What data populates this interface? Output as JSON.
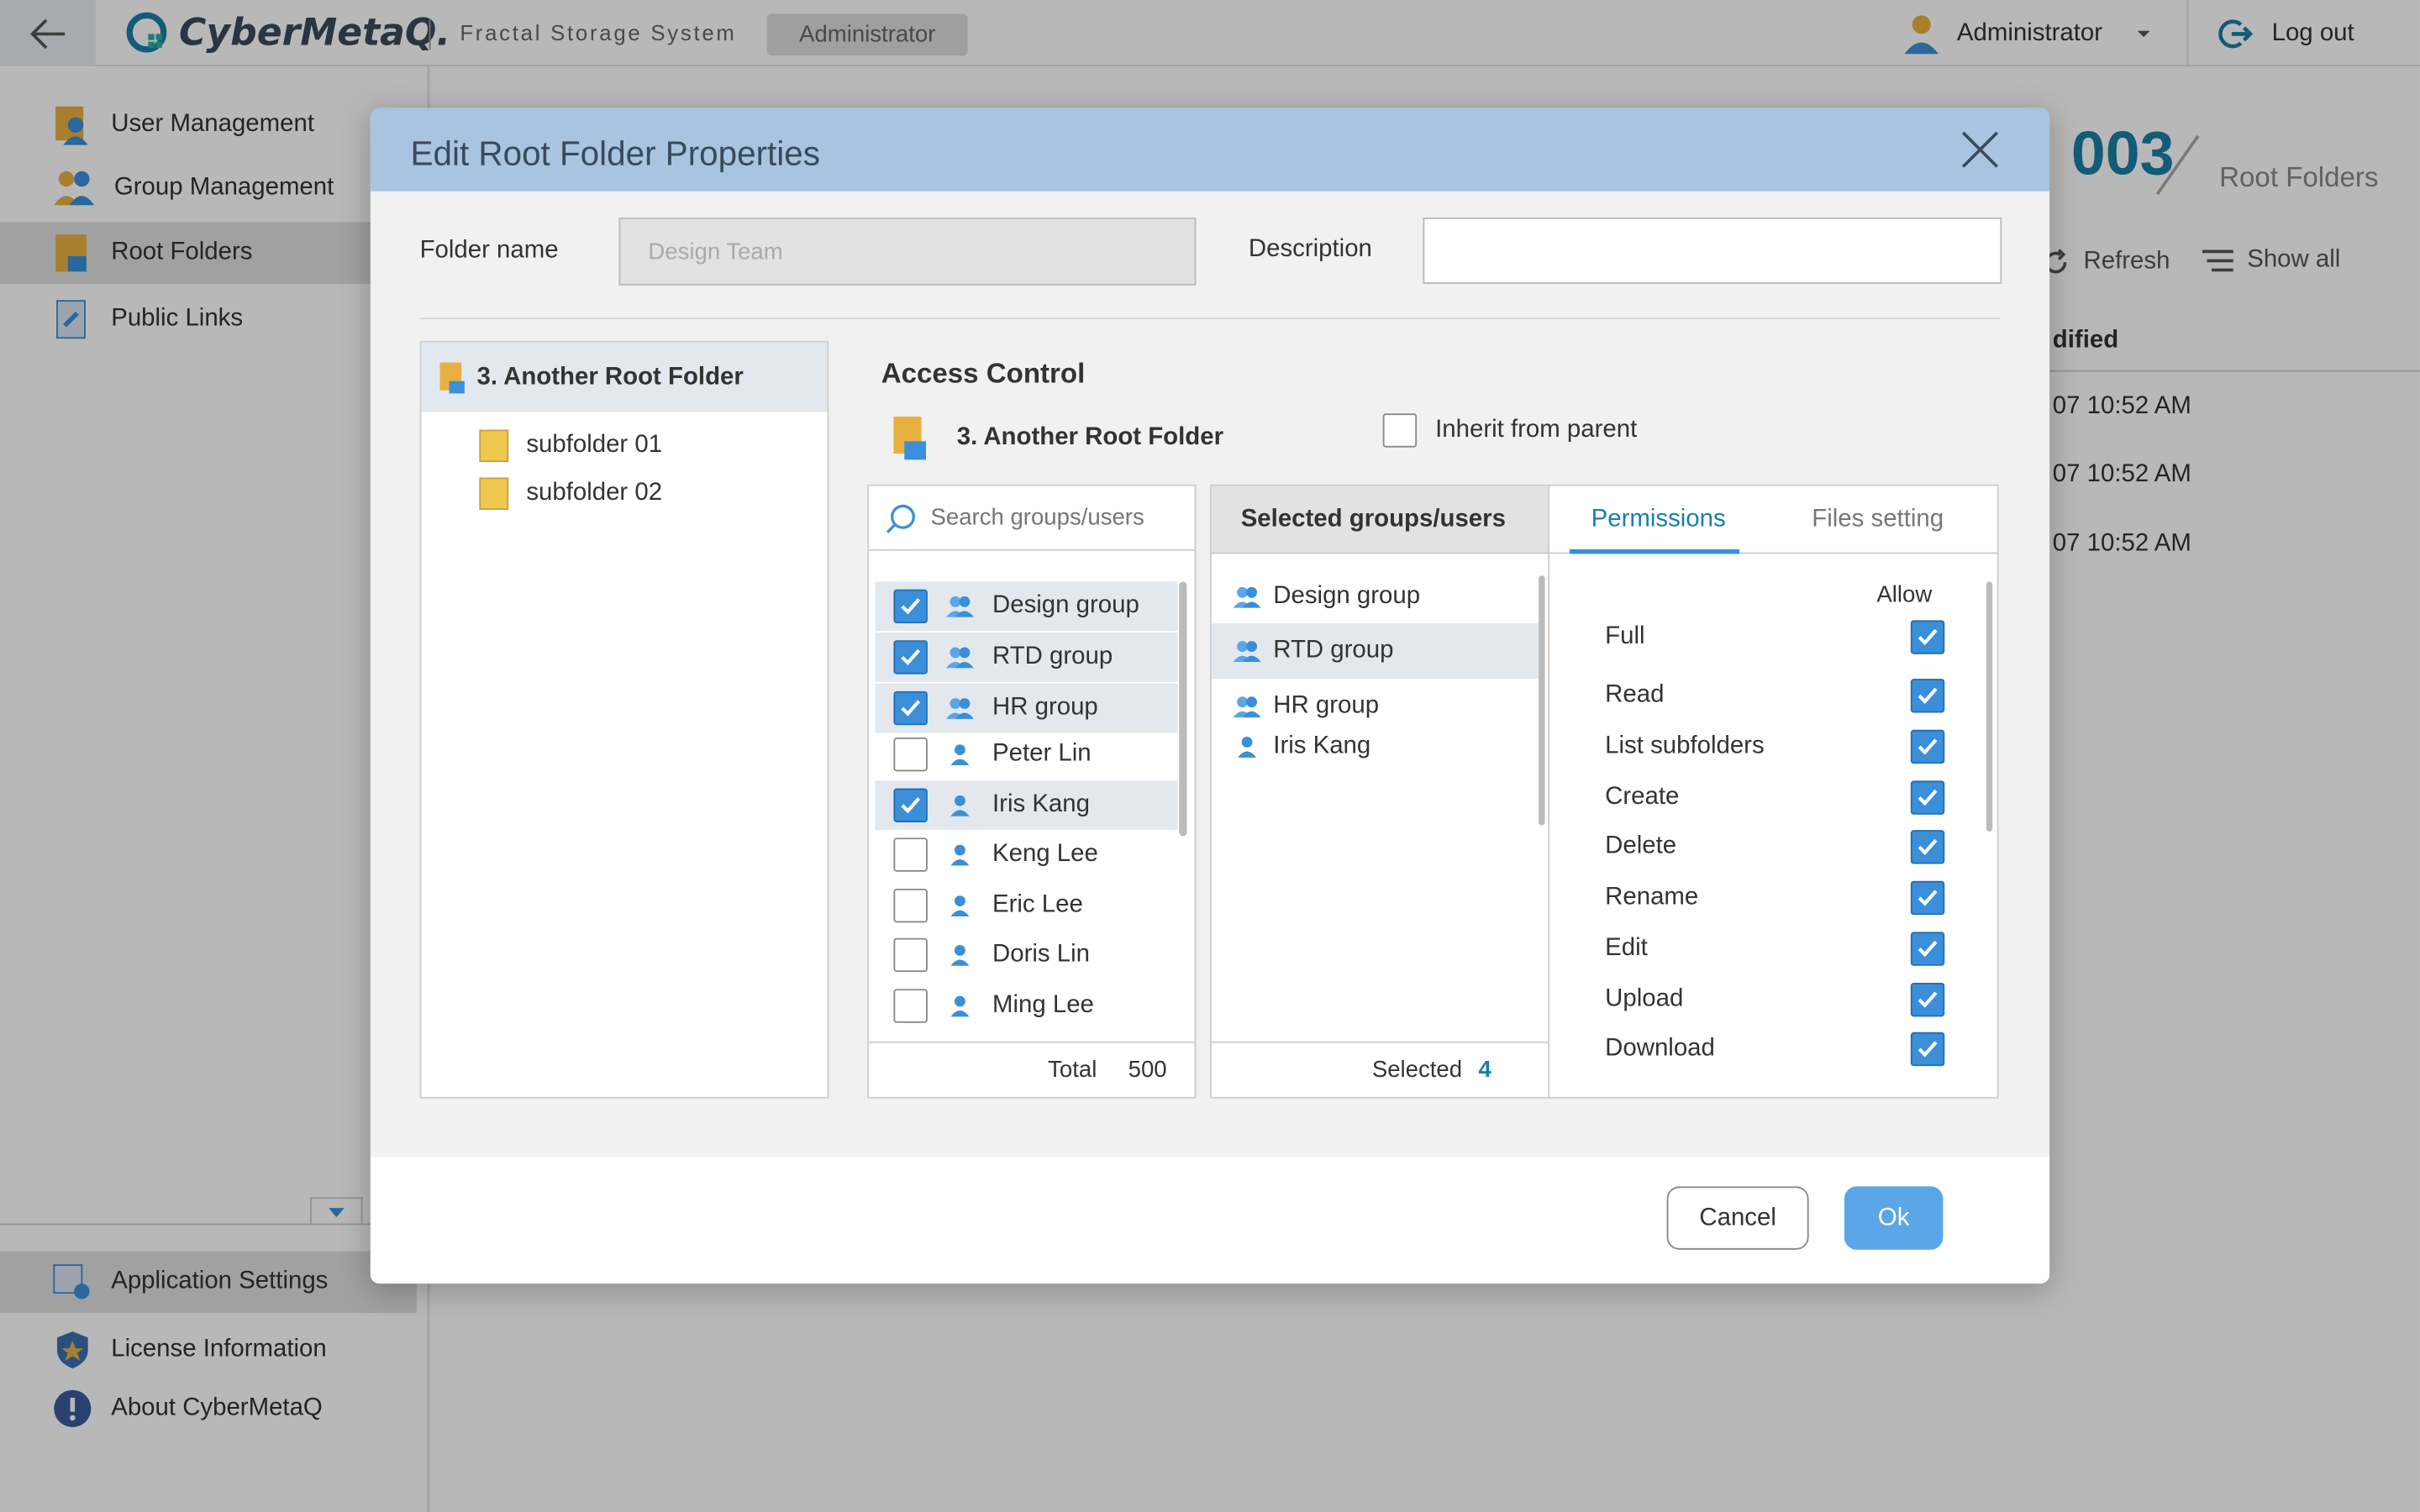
{
  "topbar": {
    "logo_text": "CyberMetaQ.",
    "system_name": "Fractal Storage System",
    "role_badge": "Administrator",
    "user_name": "Administrator",
    "logout_label": "Log out"
  },
  "sidebar": {
    "items": [
      {
        "label": "User Management",
        "icon": "user-management-icon"
      },
      {
        "label": "Group  Management",
        "icon": "group-management-icon"
      },
      {
        "label": "Root Folders",
        "icon": "root-folder-icon"
      },
      {
        "label": "Public Links",
        "icon": "public-link-icon"
      }
    ],
    "bottom_items": [
      {
        "label": "Application Settings",
        "icon": "settings-icon"
      },
      {
        "label": "License Information",
        "icon": "license-icon"
      },
      {
        "label": "About CyberMetaQ",
        "icon": "info-icon"
      }
    ]
  },
  "main": {
    "count": "003",
    "count_label": "Root Folders",
    "refresh_label": "Refresh",
    "show_all_label": "Show all",
    "column_partial": "dified",
    "dates": [
      "07 10:52 AM",
      "07 10:52 AM",
      "07 10:52 AM"
    ]
  },
  "dialog": {
    "title": "Edit Root Folder Properties",
    "folder_name_label": "Folder name",
    "folder_name_value": "Design Team",
    "description_label": "Description",
    "description_value": "",
    "tree": {
      "root": "3. Another Root Folder",
      "children": [
        "subfolder 01",
        "subfolder 02"
      ]
    },
    "access_control": {
      "title": "Access Control",
      "folder": "3. Another Root Folder",
      "inherit_label": "Inherit from parent",
      "inherit_checked": false
    },
    "search_placeholder": "Search groups/users",
    "users": [
      {
        "name": "Design group",
        "type": "group",
        "checked": true
      },
      {
        "name": "RTD group",
        "type": "group",
        "checked": true
      },
      {
        "name": "HR group",
        "type": "group",
        "checked": true
      },
      {
        "name": "Peter Lin",
        "type": "user",
        "checked": false
      },
      {
        "name": "Iris Kang",
        "type": "user",
        "checked": true
      },
      {
        "name": "Keng Lee",
        "type": "user",
        "checked": false
      },
      {
        "name": "Eric Lee",
        "type": "user",
        "checked": false
      },
      {
        "name": "Doris Lin",
        "type": "user",
        "checked": false
      },
      {
        "name": "Ming Lee",
        "type": "user",
        "checked": false
      }
    ],
    "total_label": "Total",
    "total_value": "500",
    "selected_header": "Selected groups/users",
    "selected": [
      {
        "name": "Design group",
        "type": "group"
      },
      {
        "name": "RTD group",
        "type": "group"
      },
      {
        "name": "HR group",
        "type": "group"
      },
      {
        "name": "Iris Kang",
        "type": "user"
      }
    ],
    "selected_label": "Selected",
    "selected_value": "4",
    "tabs": [
      "Permissions",
      "Files setting"
    ],
    "allow_header": "Allow",
    "permissions": [
      {
        "name": "Full",
        "allow": true
      },
      {
        "name": "Read",
        "allow": true
      },
      {
        "name": "List subfolders",
        "allow": true
      },
      {
        "name": "Create",
        "allow": true
      },
      {
        "name": "Delete",
        "allow": true
      },
      {
        "name": "Rename",
        "allow": true
      },
      {
        "name": "Edit",
        "allow": true
      },
      {
        "name": "Upload",
        "allow": true
      },
      {
        "name": "Download",
        "allow": true
      }
    ],
    "cancel_label": "Cancel",
    "ok_label": "Ok"
  },
  "colors": {
    "accent": "#1a7fa8",
    "checkbox": "#3a8fd8",
    "header": "#a8c4e0",
    "ok_button": "#5aa6e8"
  }
}
